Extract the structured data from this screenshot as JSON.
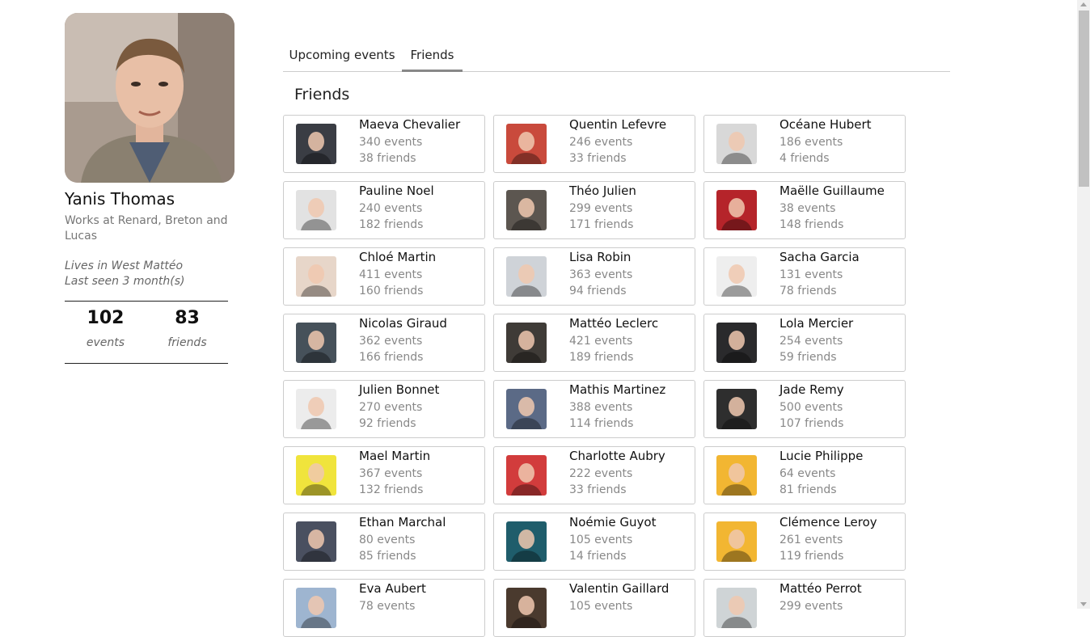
{
  "profile": {
    "name": "Yanis Thomas",
    "work": "Works at Renard, Breton and Lucas",
    "lives": "Lives in West Mattéo",
    "last_seen": "Last seen 3 month(s)",
    "events_count": "102",
    "events_label": "events",
    "friends_count": "83",
    "friends_label": "friends"
  },
  "tabs": [
    {
      "label": "Upcoming events",
      "active": false
    },
    {
      "label": "Friends",
      "active": true
    }
  ],
  "section_title": "Friends",
  "friends": [
    {
      "name": "Maeva Chevalier",
      "events": "340 events",
      "friends": "38 friends",
      "avatar": "blond-man-avatar",
      "color": "#3a3d44"
    },
    {
      "name": "Quentin Lefevre",
      "events": "246 events",
      "friends": "33 friends",
      "avatar": "drop-logo-avatar",
      "color": "#c94a3c"
    },
    {
      "name": "Océane Hubert",
      "events": "186 events",
      "friends": "4 friends",
      "avatar": "bearded-man-avatar",
      "color": "#d8d8d8"
    },
    {
      "name": "Pauline Noel",
      "events": "240 events",
      "friends": "182 friends",
      "avatar": "bw-man-avatar",
      "color": "#e2e2e2"
    },
    {
      "name": "Théo Julien",
      "events": "299 events",
      "friends": "171 friends",
      "avatar": "man-outdoors-avatar",
      "color": "#5c5650"
    },
    {
      "name": "Maëlle Guillaume",
      "events": "38 events",
      "friends": "148 friends",
      "avatar": "red-shirt-avatar",
      "color": "#b5242a"
    },
    {
      "name": "Chloé Martin",
      "events": "411 events",
      "friends": "160 friends",
      "avatar": "sunglasses-avatar",
      "color": "#e7d6c9"
    },
    {
      "name": "Lisa Robin",
      "events": "363 events",
      "friends": "94 friends",
      "avatar": "suit-man-avatar",
      "color": "#cfd3d8"
    },
    {
      "name": "Sacha Garcia",
      "events": "131 events",
      "friends": "78 friends",
      "avatar": "cap-man-avatar",
      "color": "#eeeeee"
    },
    {
      "name": "Nicolas Giraud",
      "events": "362 events",
      "friends": "166 friends",
      "avatar": "glasses-man-avatar",
      "color": "#46515a"
    },
    {
      "name": "Mattéo Leclerc",
      "events": "421 events",
      "friends": "189 friends",
      "avatar": "shades-selfie-avatar",
      "color": "#3f3b37"
    },
    {
      "name": "Lola Mercier",
      "events": "254 events",
      "friends": "59 friends",
      "avatar": "blond-man-avatar",
      "color": "#2a2a2c"
    },
    {
      "name": "Julien Bonnet",
      "events": "270 events",
      "friends": "92 friends",
      "avatar": "bearded-glasses-avatar",
      "color": "#ececec"
    },
    {
      "name": "Mathis Martinez",
      "events": "388 events",
      "friends": "114 friends",
      "avatar": "panda-avatar",
      "color": "#5b6a86"
    },
    {
      "name": "Jade Remy",
      "events": "500 events",
      "friends": "107 friends",
      "avatar": "dark-portrait-avatar",
      "color": "#2e2e2e"
    },
    {
      "name": "Mael Martin",
      "events": "367 events",
      "friends": "132 friends",
      "avatar": "yay-cartoon-avatar",
      "color": "#f0e43c"
    },
    {
      "name": "Charlotte Aubry",
      "events": "222 events",
      "friends": "33 friends",
      "avatar": "cm-logo-avatar",
      "color": "#d23c3c"
    },
    {
      "name": "Lucie Philippe",
      "events": "64 events",
      "friends": "81 friends",
      "avatar": "red-car-avatar",
      "color": "#f2b632"
    },
    {
      "name": "Ethan Marchal",
      "events": "80 events",
      "friends": "85 friends",
      "avatar": "smiling-man-avatar",
      "color": "#4a5060"
    },
    {
      "name": "Noémie Guyot",
      "events": "105 events",
      "friends": "14 friends",
      "avatar": "orange-shirt-avatar",
      "color": "#1f5d6b"
    },
    {
      "name": "Clémence Leroy",
      "events": "261 events",
      "friends": "119 friends",
      "avatar": "red-car-avatar",
      "color": "#f2b632"
    },
    {
      "name": "Eva Aubert",
      "events": "78 events",
      "friends": "",
      "avatar": "glasses-blue-avatar",
      "color": "#9eb5d0"
    },
    {
      "name": "Valentin Gaillard",
      "events": "105 events",
      "friends": "",
      "avatar": "long-hair-avatar",
      "color": "#4a3a2e"
    },
    {
      "name": "Mattéo Perrot",
      "events": "299 events",
      "friends": "",
      "avatar": "glasses-man-avatar",
      "color": "#cfd4d6"
    }
  ]
}
